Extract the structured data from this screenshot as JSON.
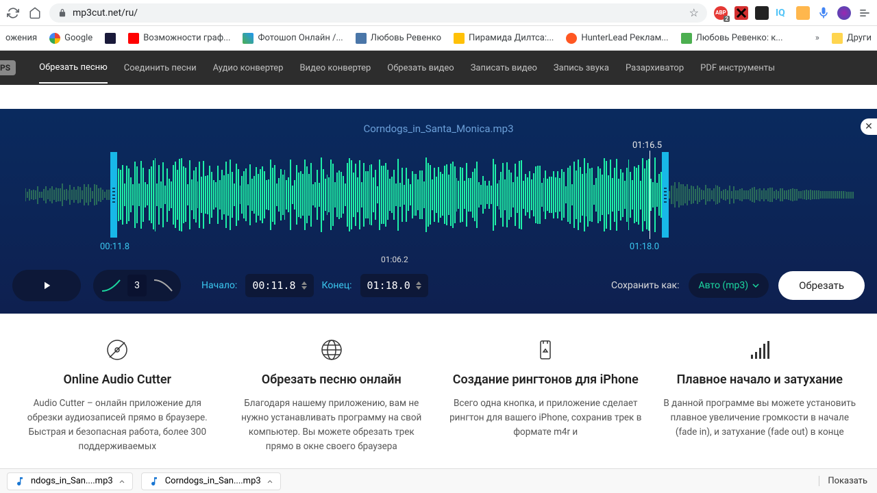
{
  "browser": {
    "url": "mp3cut.net/ru/",
    "bookmarks_partial": "ожения",
    "bookmarks": [
      {
        "label": "Google",
        "color": "#4285f4"
      },
      {
        "label": "",
        "color": "#1a1a3a"
      },
      {
        "label": "Возможности граф...",
        "color": "#ff0000"
      },
      {
        "label": "Фотошоп Онлайн /...",
        "color": "#4caf50"
      },
      {
        "label": "Любовь Ревенко",
        "color": "#4a76a8"
      },
      {
        "label": "Пирамида Дилтса:...",
        "color": "#ffc107"
      },
      {
        "label": "HunterLead Реклам...",
        "color": "#ff5722"
      },
      {
        "label": "Любовь Ревенко: к...",
        "color": "#4caf50"
      }
    ],
    "more_label": "Други"
  },
  "nav": {
    "apps": "PS",
    "items": [
      "Обрезать песню",
      "Соединить песни",
      "Аудио конвертер",
      "Видео конвертер",
      "Обрезать видео",
      "Записать видео",
      "Запись звука",
      "Разархиватор",
      "PDF инструменты"
    ],
    "active_index": 0
  },
  "editor": {
    "filename": "Corndogs_in_Santa_Monica.mp3",
    "playhead_time": "01:16.5",
    "mid_time": "01:06.2",
    "start_time_label": "00:11.8",
    "end_time_label": "01:18.0",
    "fade_count": "3",
    "start_label": "Начало:",
    "start_value": "00:11.8",
    "end_label": "Конец:",
    "end_value": "01:18.0",
    "save_as_label": "Сохранить как:",
    "format": "Авто (mp3)",
    "cut_label": "Обрезать"
  },
  "features": [
    {
      "title": "Online Audio Cutter",
      "desc": "Audio Cutter – онлайн приложение для обрезки аудиозаписей прямо в браузере. Быстрая и безопасная работа, более 300 поддерживаемых"
    },
    {
      "title": "Обрезать песню онлайн",
      "desc": "Благодаря нашему приложению, вам не нужно устанавливать программу на свой компьютер. Вы можете обрезать трек прямо в окне своего браузера"
    },
    {
      "title": "Создание рингтонов для iPhone",
      "desc": "Всего одна кнопка, и приложение сделает рингтон для вашего iPhone, сохранив трек в формате m4r и"
    },
    {
      "title": "Плавное начало и затухание",
      "desc": "В данной программе вы можете установить плавное увеличение громкости в начале (fade in), и затухание (fade out) в конце"
    }
  ],
  "downloads": {
    "items": [
      "ndogs_in_San....mp3",
      "Corndogs_in_San....mp3"
    ],
    "show_label": "Показать"
  }
}
